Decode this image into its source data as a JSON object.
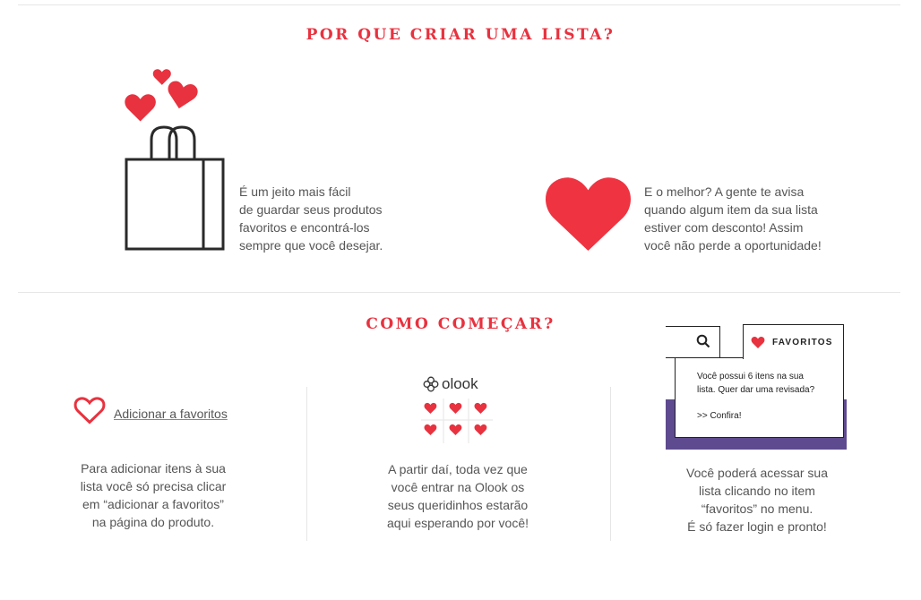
{
  "why_section": {
    "title": "POR QUE CRIAR UMA LISTA?",
    "easy_text": [
      "É um jeito mais fácil",
      "de guardar seus produtos",
      "favoritos e encontrá-los",
      "sempre que você desejar."
    ],
    "notify_text": [
      "E o melhor? A gente te avisa",
      "quando algum item da sua lista",
      "estiver com desconto!  Assim",
      "você não perde a oportunidade!"
    ]
  },
  "how_section": {
    "title": "COMO COMEÇAR?",
    "step1": {
      "link_label": "Adicionar a favoritos",
      "text": [
        "Para adicionar itens à sua",
        "lista você só precisa clicar",
        "em “adicionar a favoritos”",
        "na página do produto."
      ]
    },
    "step2": {
      "logo_label": "olook",
      "text": [
        "A partir daí, toda vez que",
        "você entrar na Olook os",
        "seus queridinhos estarão",
        "aqui esperando por você!"
      ]
    },
    "step3": {
      "favorites_tab_label": "FAVORITOS",
      "popup_text": [
        "Você possui 6 itens na sua",
        "lista. Quer dar uma revisada?"
      ],
      "popup_link": ">> Confira!",
      "text": [
        "Você poderá acessar sua",
        "lista clicando no item",
        "“favoritos” no menu.",
        "É só fazer login e pronto!"
      ]
    }
  },
  "colors": {
    "accent": "#e8323f",
    "text": "#555555",
    "menu_purple": "#5e4a8f"
  },
  "icons": [
    "hearts-icon",
    "shopping-bag-icon",
    "big-heart-icon",
    "heart-outline-icon",
    "olook-logo-icon",
    "search-icon"
  ]
}
